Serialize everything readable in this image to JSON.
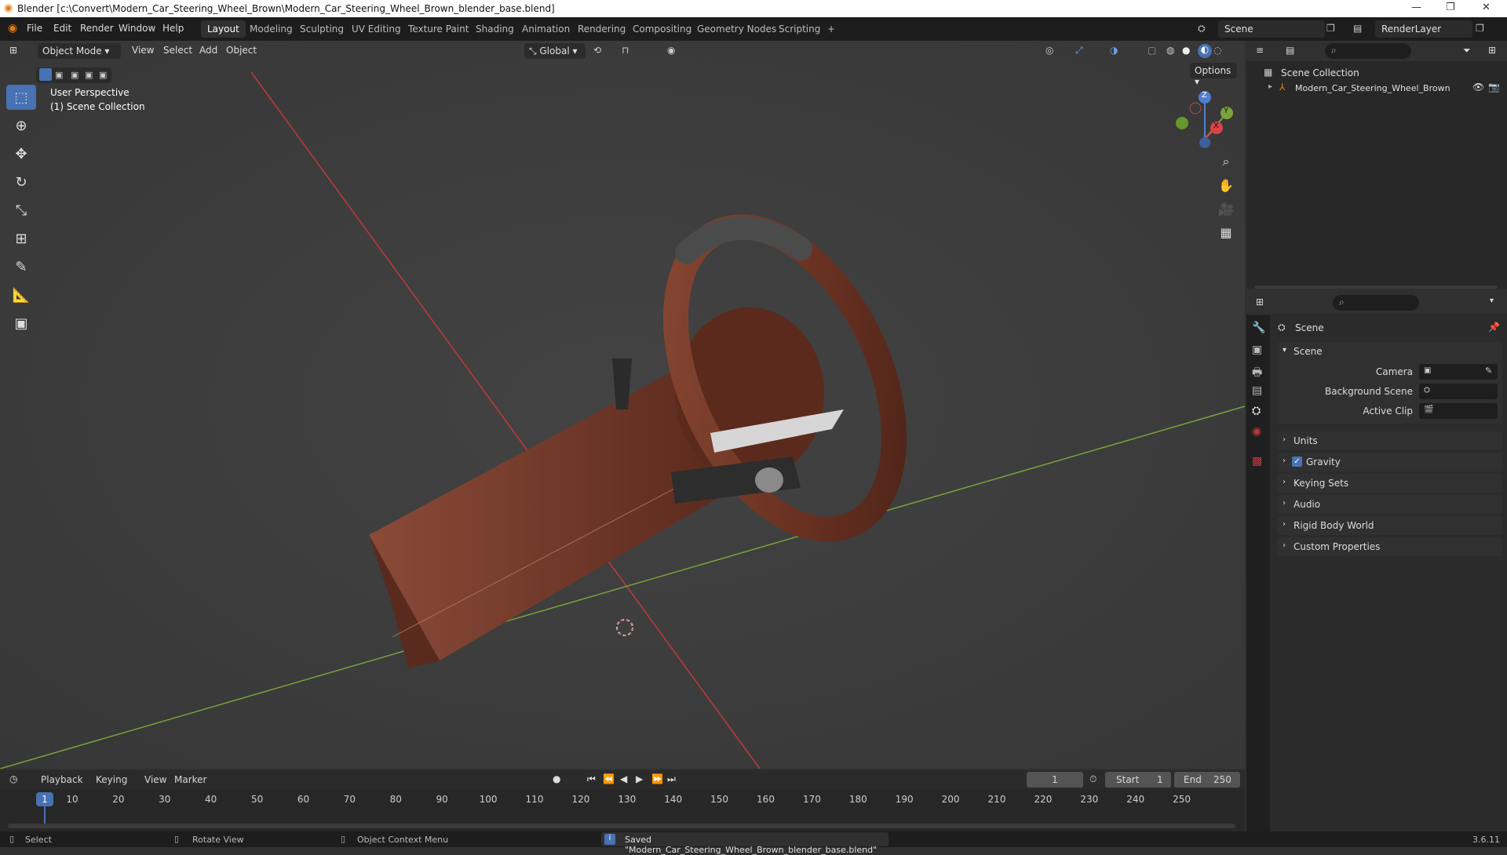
{
  "window": {
    "title": "Blender [c:\\Convert\\Modern_Car_Steering_Wheel_Brown\\Modern_Car_Steering_Wheel_Brown_blender_base.blend]"
  },
  "menus": [
    "File",
    "Edit",
    "Render",
    "Window",
    "Help"
  ],
  "workspaces": [
    "Layout",
    "Modeling",
    "Sculpting",
    "UV Editing",
    "Texture Paint",
    "Shading",
    "Animation",
    "Rendering",
    "Compositing",
    "Geometry Nodes",
    "Scripting",
    "+"
  ],
  "scene_selector": "Scene",
  "renderlayer_selector": "RenderLayer",
  "viewport": {
    "mode": "Object Mode",
    "menus": [
      "View",
      "Select",
      "Add",
      "Object"
    ],
    "transform_orientation": "Global",
    "options_label": "Options",
    "overlay_line1": "User Perspective",
    "overlay_line2": "(1) Scene Collection",
    "gizmo": {
      "z": "Z",
      "y": "Y",
      "x": "X"
    },
    "tools": [
      "select-box-icon",
      "cursor-icon",
      "move-icon",
      "rotate-icon",
      "scale-icon",
      "transform-icon",
      "annotate-icon",
      "measure-icon",
      "add-cube-icon"
    ]
  },
  "outliner": {
    "root": "Scene Collection",
    "items": [
      {
        "name": "Modern_Car_Steering_Wheel_Brown"
      }
    ]
  },
  "properties": {
    "header": "Scene",
    "section": "Scene",
    "fields": [
      {
        "label": "Camera"
      },
      {
        "label": "Background Scene"
      },
      {
        "label": "Active Clip"
      }
    ],
    "panels": [
      "Units",
      "Gravity",
      "Keying Sets",
      "Audio",
      "Rigid Body World",
      "Custom Properties"
    ],
    "gravity_checked": true
  },
  "timeline": {
    "menus": [
      "Playback",
      "Keying",
      "View",
      "Marker"
    ],
    "current_frame": "1",
    "start_label": "Start",
    "start": "1",
    "end_label": "End",
    "end": "250",
    "ticks": [
      "10",
      "20",
      "30",
      "40",
      "50",
      "60",
      "70",
      "80",
      "90",
      "100",
      "110",
      "120",
      "130",
      "140",
      "150",
      "160",
      "170",
      "180",
      "190",
      "200",
      "210",
      "220",
      "230",
      "240",
      "250"
    ],
    "playhead": "1"
  },
  "statusbar": {
    "select": "Select",
    "rotate": "Rotate View",
    "context": "Object Context Menu",
    "message": "Saved \"Modern_Car_Steering_Wheel_Brown_blender_base.blend\"",
    "version": "3.6.11"
  },
  "colors": {
    "accent": "#4772b3",
    "x_axis": "#c0393b",
    "y_axis": "#7ba33a",
    "object": "#6b3222"
  }
}
